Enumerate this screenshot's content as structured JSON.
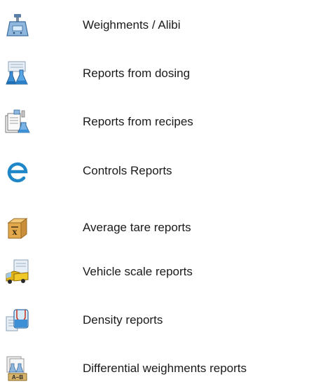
{
  "menu": {
    "items": [
      {
        "label": "Weighments / Alibi",
        "icon": "scale-icon"
      },
      {
        "label": "Reports from dosing",
        "icon": "dosing-flasks-icon"
      },
      {
        "label": "Reports from recipes",
        "icon": "recipes-icon"
      },
      {
        "label": "Controls Reports",
        "icon": "controls-e-icon"
      },
      {
        "label": "Average tare reports",
        "icon": "average-tare-box-icon"
      },
      {
        "label": "Vehicle scale reports",
        "icon": "truck-icon"
      },
      {
        "label": "Density reports",
        "icon": "density-beaker-icon"
      },
      {
        "label": "Differential weighments reports",
        "icon": "differential-ab-icon"
      }
    ]
  }
}
